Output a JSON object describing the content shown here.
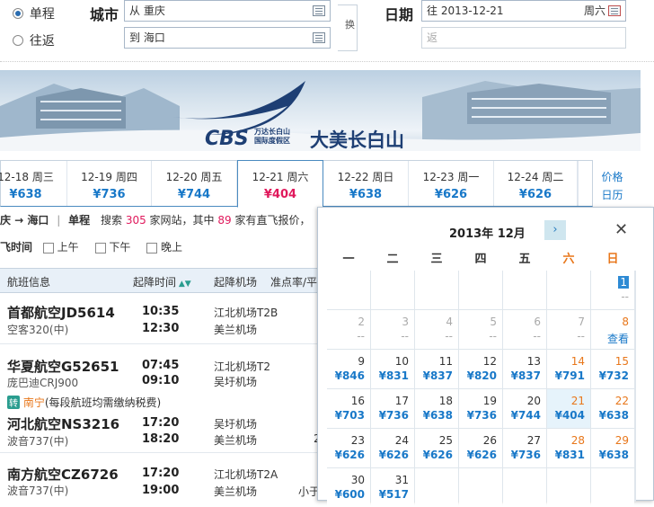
{
  "search": {
    "trip_oneway": "单程",
    "trip_roundtrip": "往返",
    "city_label": "城市",
    "from_value": "从 重庆",
    "to_value": "到 海口",
    "swap_label": "换",
    "date_label": "日期",
    "depart_value": "往 2013-12-21",
    "depart_weekday": "周六",
    "return_placeholder": "返"
  },
  "banner": {
    "logo_text": "CBS",
    "logo_small_1": "万达长白山",
    "logo_small_2": "国际度假区",
    "logo_big": "大美长白山"
  },
  "date_tabs": [
    {
      "date": "12-18 周三",
      "price": "¥638"
    },
    {
      "date": "12-19 周四",
      "price": "¥736"
    },
    {
      "date": "12-20 周五",
      "price": "¥744"
    },
    {
      "date": "12-21 周六",
      "price": "¥404"
    },
    {
      "date": "12-22 周日",
      "price": "¥638"
    },
    {
      "date": "12-23 周一",
      "price": "¥626"
    },
    {
      "date": "12-24 周二",
      "price": "¥626"
    }
  ],
  "price_calendar_link": {
    "line1": "价格",
    "line2": "日历"
  },
  "summary": {
    "route": "庆 → 海口",
    "sep": "|",
    "type": "单程",
    "search_pre": "搜索",
    "site_count": "305",
    "search_mid": "家网站，其中",
    "direct_count": "89",
    "search_post": "家有直飞报价，"
  },
  "filter": {
    "label": "飞时间",
    "morning": "上午",
    "afternoon": "下午",
    "evening": "晚上"
  },
  "table_headers": {
    "flight": "航班信息",
    "times": "起降时间",
    "airports": "起降机场",
    "ontime": "准点率/平"
  },
  "flights": [
    {
      "airline": "首都航空JD5614",
      "plane": "空客320(中)",
      "dep": "10:35",
      "arr": "12:30",
      "dep_ap": "江北机场T2B",
      "arr_ap": "美兰机场",
      "extra": ""
    },
    {
      "airline": "华夏航空G52651",
      "plane": "庞巴迪CRJ900",
      "dep": "07:45",
      "arr": "09:10",
      "dep_ap": "江北机场T2",
      "arr_ap": "吴圩机场",
      "extra": ""
    },
    {
      "airline": "河北航空NS3216",
      "plane": "波音737(中)",
      "dep": "17:20",
      "arr": "18:20",
      "dep_ap": "吴圩机场",
      "arr_ap": "美兰机场",
      "extra": "2"
    },
    {
      "airline": "南方航空CZ6726",
      "plane": "波音737(中)",
      "dep": "17:20",
      "arr": "19:00",
      "dep_ap": "江北机场T2A",
      "arr_ap": "美兰机场",
      "extra": "小于"
    }
  ],
  "transfer": {
    "badge": "转",
    "city": "南宁",
    "note": "(每段航班均需缴纳税费)"
  },
  "calendar": {
    "title": "2013年 12月",
    "weekdays": [
      "一",
      "二",
      "三",
      "四",
      "五",
      "六",
      "日"
    ],
    "view_label": "查看",
    "today_day": "1",
    "today_price": "--",
    "row1": [
      {
        "d": "2",
        "p": "--"
      },
      {
        "d": "3",
        "p": "--"
      },
      {
        "d": "4",
        "p": "--"
      },
      {
        "d": "5",
        "p": "--"
      },
      {
        "d": "6",
        "p": "--"
      },
      {
        "d": "7",
        "p": "--"
      },
      {
        "d": "8",
        "p": ""
      }
    ],
    "row2": [
      {
        "d": "9",
        "p": "¥846"
      },
      {
        "d": "10",
        "p": "¥831"
      },
      {
        "d": "11",
        "p": "¥837"
      },
      {
        "d": "12",
        "p": "¥820"
      },
      {
        "d": "13",
        "p": "¥837"
      },
      {
        "d": "14",
        "p": "¥791"
      },
      {
        "d": "15",
        "p": "¥732"
      }
    ],
    "row3": [
      {
        "d": "16",
        "p": "¥703"
      },
      {
        "d": "17",
        "p": "¥736"
      },
      {
        "d": "18",
        "p": "¥638"
      },
      {
        "d": "19",
        "p": "¥736"
      },
      {
        "d": "20",
        "p": "¥744"
      },
      {
        "d": "21",
        "p": "¥404"
      },
      {
        "d": "22",
        "p": "¥638"
      }
    ],
    "row4": [
      {
        "d": "23",
        "p": "¥626"
      },
      {
        "d": "24",
        "p": "¥626"
      },
      {
        "d": "25",
        "p": "¥626"
      },
      {
        "d": "26",
        "p": "¥626"
      },
      {
        "d": "27",
        "p": "¥736"
      },
      {
        "d": "28",
        "p": "¥831"
      },
      {
        "d": "29",
        "p": "¥638"
      }
    ],
    "row5": [
      {
        "d": "30",
        "p": "¥600"
      },
      {
        "d": "31",
        "p": "¥517"
      }
    ]
  },
  "colors": {
    "accent": "#1878c8",
    "price_highlight": "#e0195c",
    "weekend": "#e8771b"
  }
}
